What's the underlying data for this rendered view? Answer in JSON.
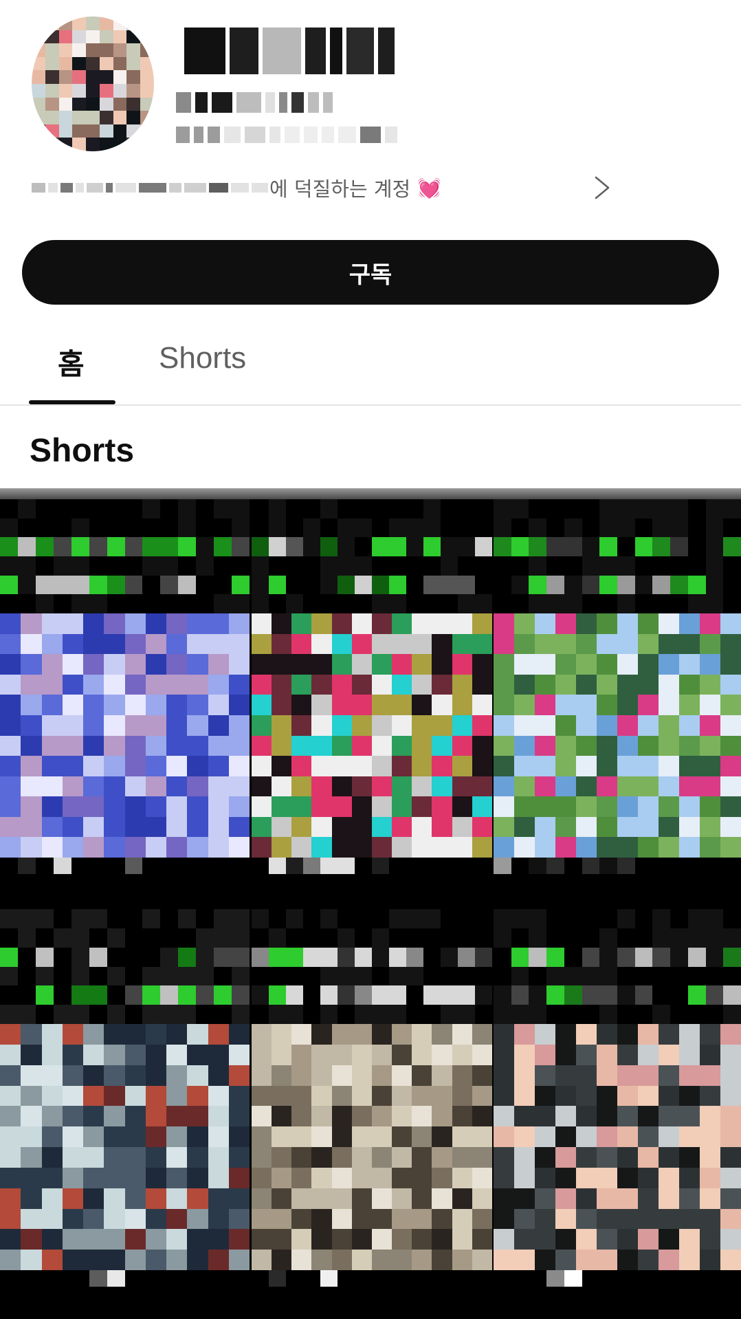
{
  "channel": {
    "name_redacted": true,
    "description_suffix": "에 덕질하는 계정",
    "description_emoji": "💓",
    "avatar_palette": [
      "#f6f1ee",
      "#b89484",
      "#f0c9b4",
      "#3b2f2f",
      "#1b1a22",
      "#c7cbb8",
      "#e8b9a2",
      "#d8d8dc",
      "#0f1418",
      "#e7707f",
      "#c9d7dc",
      "#8a6a5c"
    ],
    "name_palette": [
      "#111111",
      "#111111",
      "#1e1e1e",
      "#b8b8b8",
      "#d0d0d0",
      "#2a2a2a"
    ],
    "handle_palette": [
      "#bdbdbd",
      "#333333",
      "#1a1a1a",
      "#e0e0e0",
      "#8a8a8a"
    ],
    "stats_palette": [
      "#eeeeee",
      "#d6d6d6",
      "#7a7a7a",
      "#9c9c9c",
      "#e6e6e6"
    ],
    "desc_palette": [
      "#e2e2e2",
      "#cfcfcf",
      "#7a7a7a",
      "#9a9a9a",
      "#5e5e5e",
      "#bdbdbd"
    ]
  },
  "subscribe_button": {
    "label": "구독"
  },
  "tabs": [
    {
      "label": "홈",
      "active": true
    },
    {
      "label": "Shorts",
      "active": false
    }
  ],
  "section": {
    "title": "Shorts"
  },
  "shorts": [
    {
      "caption_palette": [
        "#000000",
        "#111111",
        "#bdbdbd",
        "#2ecc2e",
        "#1a8f1a",
        "#444444"
      ],
      "thumb_palette": [
        "#3f4fc7",
        "#2d3bb0",
        "#c8cdf5",
        "#9aa8ee",
        "#b79ac8",
        "#7466c2",
        "#e8e8ff",
        "#5a6ad8"
      ],
      "footer_palette": [
        "#000000",
        "#d8d8d8",
        "#222222",
        "#5a5a5a"
      ]
    },
    {
      "caption_palette": [
        "#000000",
        "#111111",
        "#2ecc2e",
        "#d0d0d0",
        "#0f5f0f",
        "#555555"
      ],
      "thumb_palette": [
        "#e0356a",
        "#1b1317",
        "#2a9e5a",
        "#c9c9c9",
        "#6b2a38",
        "#aaa040",
        "#efefef",
        "#24d0d0"
      ],
      "footer_palette": [
        "#000000",
        "#e0e0e0",
        "#1e1e1e",
        "#7a7a7a"
      ]
    },
    {
      "caption_palette": [
        "#000000",
        "#111111",
        "#2ecc2e",
        "#1e8a1e",
        "#9a9a9a",
        "#333333"
      ],
      "thumb_palette": [
        "#a9cdf0",
        "#e6eef8",
        "#6aa0d8",
        "#5b9a4a",
        "#4f8f3c",
        "#d93b86",
        "#2f5f3f",
        "#7cb25c"
      ],
      "footer_palette": [
        "#000000",
        "#2b2b2b",
        "#9a9a9a",
        "#111111"
      ]
    },
    {
      "caption_palette": [
        "#000000",
        "#1a1a1a",
        "#2ecc2e",
        "#c0c0c0",
        "#147a14",
        "#444444"
      ],
      "thumb_palette": [
        "#c9d9dc",
        "#2a3a4a",
        "#8a9aa0",
        "#6a2a2a",
        "#d8e4e8",
        "#1e2a3a",
        "#b34a3a",
        "#4a5a6a"
      ],
      "footer_palette": [
        "#000000",
        "#e8e8e8",
        "#1a1a1a",
        "#5c5c5c"
      ]
    },
    {
      "caption_palette": [
        "#000000",
        "#141414",
        "#2ecc2e",
        "#d8d8d8",
        "#888888",
        "#333333"
      ],
      "thumb_palette": [
        "#d6cdb8",
        "#a69a86",
        "#2a2420",
        "#7a6e5e",
        "#c2b8a6",
        "#e8e2d6",
        "#4a4236",
        "#8c8474"
      ],
      "footer_palette": [
        "#000000",
        "#f0f0f0",
        "#2a2a2a",
        "#6a6a6a"
      ]
    },
    {
      "caption_palette": [
        "#000000",
        "#121212",
        "#2ecc2e",
        "#bcbcbc",
        "#1a7a1a",
        "#444444"
      ],
      "thumb_palette": [
        "#161818",
        "#2c3234",
        "#e8b8a6",
        "#f2cdb8",
        "#4a5256",
        "#c8cdd0",
        "#363c3e",
        "#d89a9a"
      ],
      "footer_palette": [
        "#000000",
        "#ffffff",
        "#1e1e1e",
        "#8a8a8a"
      ]
    }
  ]
}
